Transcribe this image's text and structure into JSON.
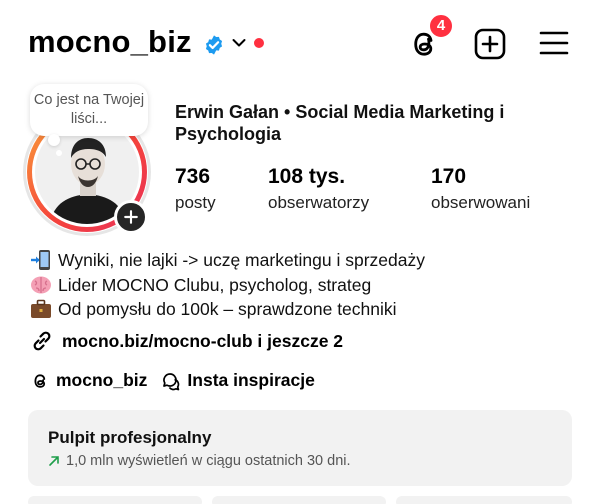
{
  "header": {
    "username": "mocno_biz",
    "threads_badge_count": "4"
  },
  "profile": {
    "note_text": "Co jest na Twojej liści...",
    "full_name": "Erwin Gałan • Social Media Marketing i Psychologia",
    "stats": [
      {
        "value": "736",
        "label": "posty"
      },
      {
        "value": "108 tys.",
        "label": "obserwatorzy"
      },
      {
        "value": "170",
        "label": "obserwowani"
      }
    ]
  },
  "bio": {
    "lines": [
      {
        "icon": "mobile-phone-arrow-icon",
        "text": "Wyniki, nie lajki -> uczę marketingu i sprzedaży"
      },
      {
        "icon": "brain-icon",
        "text": "Lider MOCNO Clubu, psycholog, strateg"
      },
      {
        "icon": "briefcase-icon",
        "text": "Od pomysłu do 100k – sprawdzone techniki"
      }
    ],
    "link_text": "mocno.biz/mocno-club i jeszcze 2"
  },
  "chips": {
    "threads_label": "mocno_biz",
    "insta_label": "Insta inspiracje"
  },
  "dashboard": {
    "title": "Pulpit profesjonalny",
    "subtitle": "1,0 mln wyświetleń w ciągu ostatnich 30 dni."
  },
  "colors": {
    "accent_red": "#ff3040",
    "verified_blue": "#1d9bf0",
    "trend_green": "#1e9e4a",
    "ring_gradient": [
      "#f9a13a",
      "#f5443b",
      "#e8305a"
    ]
  }
}
